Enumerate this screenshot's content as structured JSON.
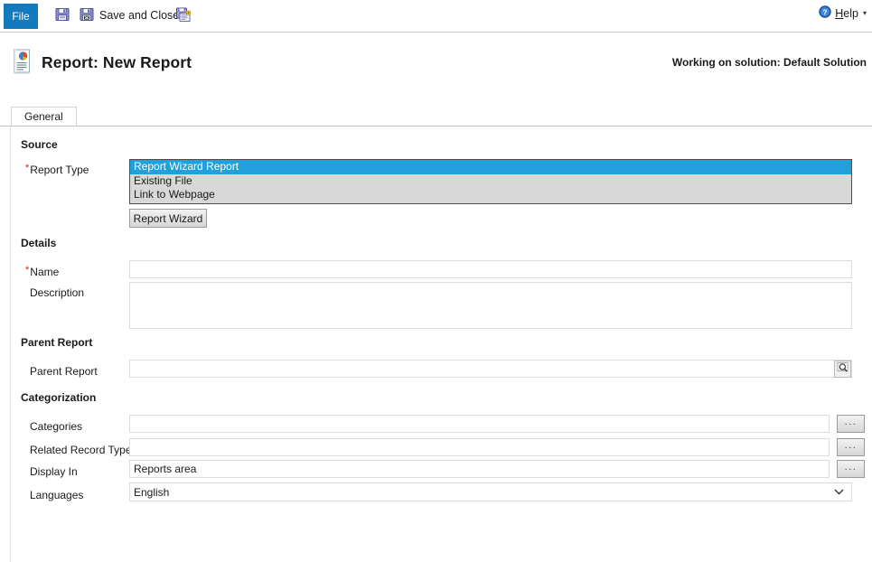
{
  "ribbon": {
    "file_tab": "File",
    "save_label": "Save",
    "save_icon": "floppy-disk-icon",
    "save_and_close_label": "Save and Close",
    "save_and_close_icon": "floppy-disk-close-icon",
    "save_and_new_label": "Save and New",
    "save_and_new_icon": "floppy-disk-new-icon",
    "help_label_prefix": "",
    "help_label_accel": "H",
    "help_label_rest": "elp",
    "help_icon": "help-question-icon",
    "help_caret": "▾"
  },
  "header": {
    "title": "Report: New Report",
    "icon": "report-document-chart-icon",
    "solution_note": "Working on solution: Default Solution"
  },
  "tabs": [
    {
      "label": "General",
      "selected": true
    }
  ],
  "sections": {
    "source": {
      "heading": "Source",
      "report_type": {
        "label": "Report Type",
        "required": true,
        "options": [
          {
            "label": "Report Wizard Report",
            "selected": true
          },
          {
            "label": "Existing File",
            "selected": false
          },
          {
            "label": "Link to Webpage",
            "selected": false
          }
        ]
      },
      "report_wizard_button": "Report Wizard"
    },
    "details": {
      "heading": "Details",
      "name": {
        "label": "Name",
        "required": true,
        "value": "",
        "placeholder": ""
      },
      "description": {
        "label": "Description",
        "required": false,
        "value": "",
        "placeholder": ""
      }
    },
    "parent_report": {
      "heading": "Parent Report",
      "parent_report": {
        "label": "Parent Report",
        "required": false,
        "value": "",
        "placeholder": "",
        "lookup_icon": "magnifier-lookup-icon"
      }
    },
    "categorization": {
      "heading": "Categorization",
      "categories": {
        "label": "Categories",
        "value": "",
        "placeholder": "",
        "browse_button": "...",
        "browse_icon": "ellipsis-icon"
      },
      "related_record_types": {
        "label": "Related Record Types",
        "value": "",
        "placeholder": "",
        "browse_button": "...",
        "browse_icon": "ellipsis-icon"
      },
      "display_in": {
        "label": "Display In",
        "value": "Reports area",
        "placeholder": "",
        "browse_button": "...",
        "browse_icon": "ellipsis-icon"
      },
      "languages": {
        "label": "Languages",
        "value": "English",
        "caret": "⌄",
        "caret_icon": "chevron-down-icon"
      }
    }
  },
  "colors": {
    "accent_blue": "#1579bd",
    "selection_blue": "#21a0da",
    "listbox_bg": "#d8d8d8",
    "required_red": "#cc2200",
    "field_border": "#dcdcdc"
  }
}
